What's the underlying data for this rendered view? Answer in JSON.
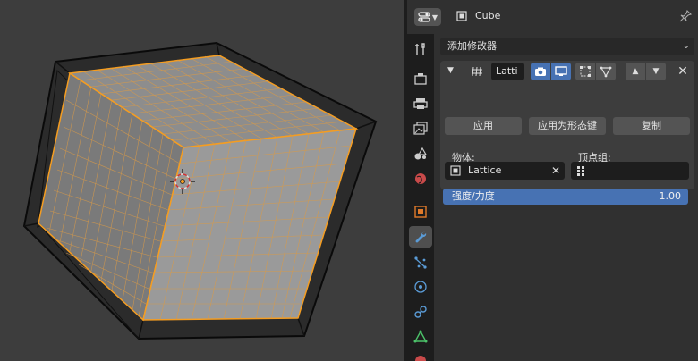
{
  "header": {
    "object_name": "Cube",
    "editor_icon": "properties-editor-icon",
    "pin_icon": "pin-icon"
  },
  "tabs": [
    {
      "name": "tool-tab",
      "icon": "tool-icon"
    },
    {
      "name": "render-tab",
      "icon": "camera-back-icon"
    },
    {
      "name": "output-tab",
      "icon": "printer-icon"
    },
    {
      "name": "view-layer-tab",
      "icon": "image-stack-icon"
    },
    {
      "name": "scene-tab",
      "icon": "scene-icon"
    },
    {
      "name": "world-tab",
      "icon": "world-icon"
    },
    {
      "name": "object-tab",
      "icon": "object-square-icon"
    },
    {
      "name": "modifiers-tab",
      "icon": "wrench-icon",
      "active": true
    },
    {
      "name": "particles-tab",
      "icon": "particles-icon"
    },
    {
      "name": "physics-tab",
      "icon": "physics-icon"
    },
    {
      "name": "constraints-tab",
      "icon": "constraint-icon"
    },
    {
      "name": "data-tab",
      "icon": "mesh-data-icon"
    },
    {
      "name": "material-tab",
      "icon": "material-icon"
    }
  ],
  "add_modifier": {
    "label": "添加修改器"
  },
  "modifier": {
    "name": "Latti",
    "apply_label": "应用",
    "apply_shape_label": "应用为形态键",
    "copy_label": "复制",
    "object_label": "物体:",
    "object_value": "Lattice",
    "vertex_group_label": "顶点组:",
    "vertex_group_value": "",
    "strength_label": "强度/力度",
    "strength_value": "1.00",
    "show_render": true,
    "show_viewport": true,
    "show_editmode": false,
    "show_cage": false
  },
  "colors": {
    "accent": "#4772b3",
    "selection": "#f59d21",
    "background": "#303030"
  }
}
